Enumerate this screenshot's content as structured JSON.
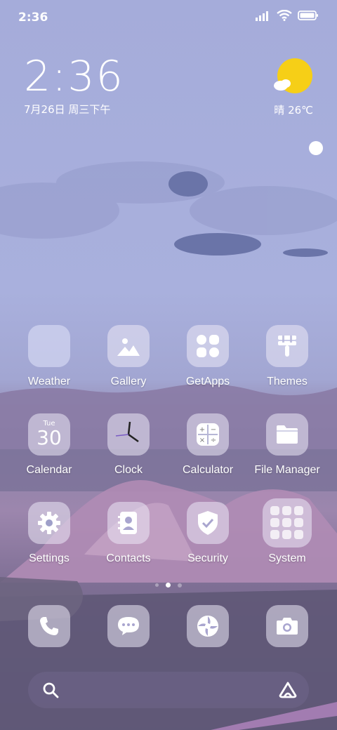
{
  "status": {
    "time": "2:36"
  },
  "clock_widget": {
    "time": "2:36",
    "date": "7月26日 周三下午"
  },
  "weather_widget": {
    "condition": "晴",
    "temperature": "26℃"
  },
  "apps": [
    {
      "label": "Weather"
    },
    {
      "label": "Gallery"
    },
    {
      "label": "GetApps"
    },
    {
      "label": "Themes"
    },
    {
      "label": "Calendar"
    },
    {
      "label": "Clock"
    },
    {
      "label": "Calculator"
    },
    {
      "label": "File Manager"
    },
    {
      "label": "Settings"
    },
    {
      "label": "Contacts"
    },
    {
      "label": "Security"
    },
    {
      "label": "System"
    }
  ],
  "calendar_icon": {
    "day": "Tue",
    "date": "30"
  },
  "dock": [
    {
      "name": "Phone"
    },
    {
      "name": "Messages"
    },
    {
      "name": "Browser"
    },
    {
      "name": "Camera"
    }
  ],
  "pages": {
    "count": 3,
    "current": 2
  }
}
